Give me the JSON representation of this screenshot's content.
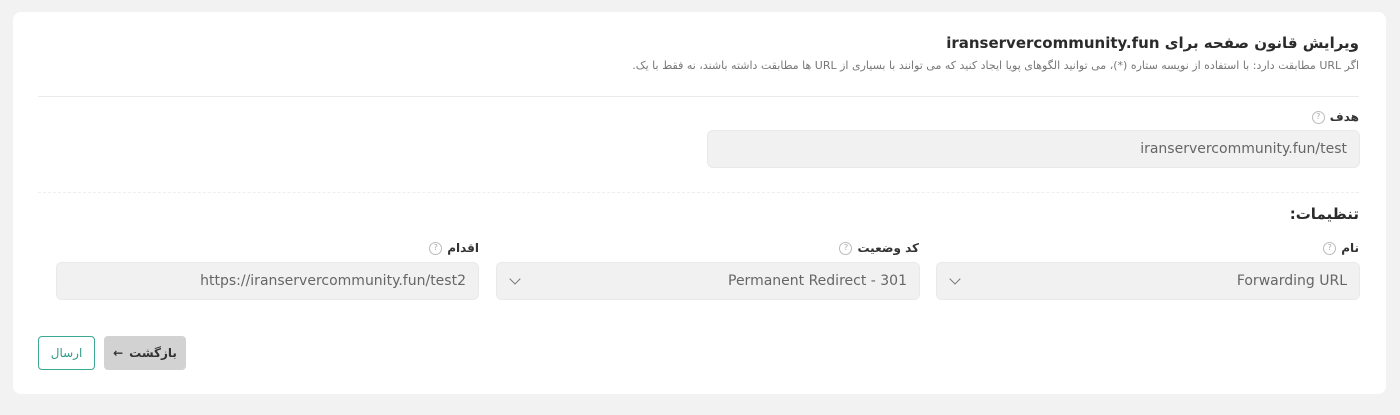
{
  "header": {
    "title": "ویرایش قانون صفحه برای iranservercommunity.fun",
    "subtitle": "اگر URL مطابقت دارد: با استفاده از نویسه ستاره (*)، می توانید الگوهای پویا ایجاد کنید که می توانند با بسیاری از URL ها مطابقت داشته باشند، نه فقط با یک."
  },
  "target": {
    "label": "هدف",
    "value": "iranservercommunity.fun/test"
  },
  "settings": {
    "title": "تنظیمات:",
    "name_label": "نام",
    "name_value": "Forwarding URL",
    "status_label": "کد وضعیت",
    "status_value": "Permanent Redirect - 301",
    "action_label": "اقدام",
    "action_value": "https://iranservercommunity.fun/test2"
  },
  "buttons": {
    "back_label": "بازگشت",
    "back_arrow": "←",
    "submit_label": "ارسال"
  },
  "icons": {
    "help": "?"
  },
  "colors": {
    "submit_border": "#3aa892",
    "back_bg": "#d2d2d2"
  }
}
